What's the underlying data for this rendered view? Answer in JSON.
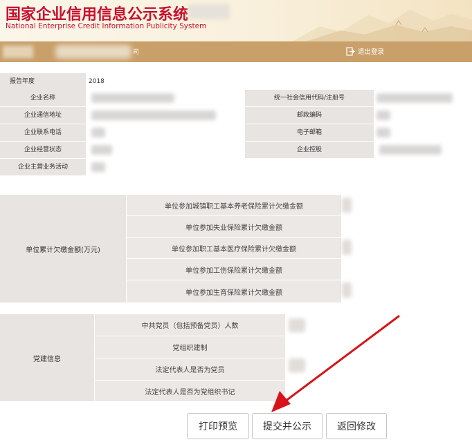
{
  "header": {
    "title_cn": "国家企业信用信息公示系统",
    "title_en": "National Enterprise Credit Information Publicity System"
  },
  "navbar": {
    "tail_text": "司",
    "logout_label": "退出登录",
    "logout_icon": "logout-icon"
  },
  "basic_info": {
    "report_year_label": "报告年度",
    "report_year_value": "2018",
    "company_name_label": "企业名称",
    "credit_code_label": "统一社会信用代码/注册号",
    "address_label": "企业通信地址",
    "postcode_label": "邮政编码",
    "phone_label": "企业联系电话",
    "email_label": "电子邮箱",
    "status_label": "企业经营状态",
    "holding_label": "企业控股",
    "main_business_label": "企业主营业务活动"
  },
  "arrears": {
    "side_label": "单位累计欠缴金额(万元)",
    "items": [
      "单位参加城镇职工基本养老保险累计欠缴金额",
      "单位参加失业保险累计欠缴金额",
      "单位参加职工基本医疗保险累计欠缴金额",
      "单位参加工伤保险累计欠缴金额",
      "单位参加生育保险累计欠缴金额"
    ]
  },
  "party": {
    "side_label": "党建信息",
    "items": [
      "中共党员（包括预备党员）人数",
      "党组织建制",
      "法定代表人是否为党员",
      "法定代表人是否为党组织书记"
    ]
  },
  "buttons": {
    "print_preview": "打印预览",
    "submit": "提交并公示",
    "back_edit": "返回修改"
  },
  "colors": {
    "brand_red": "#c8102e",
    "nav_gold": "#c9a06a",
    "label_bg": "#e8e4e1",
    "annotation_red": "#d8141a"
  }
}
